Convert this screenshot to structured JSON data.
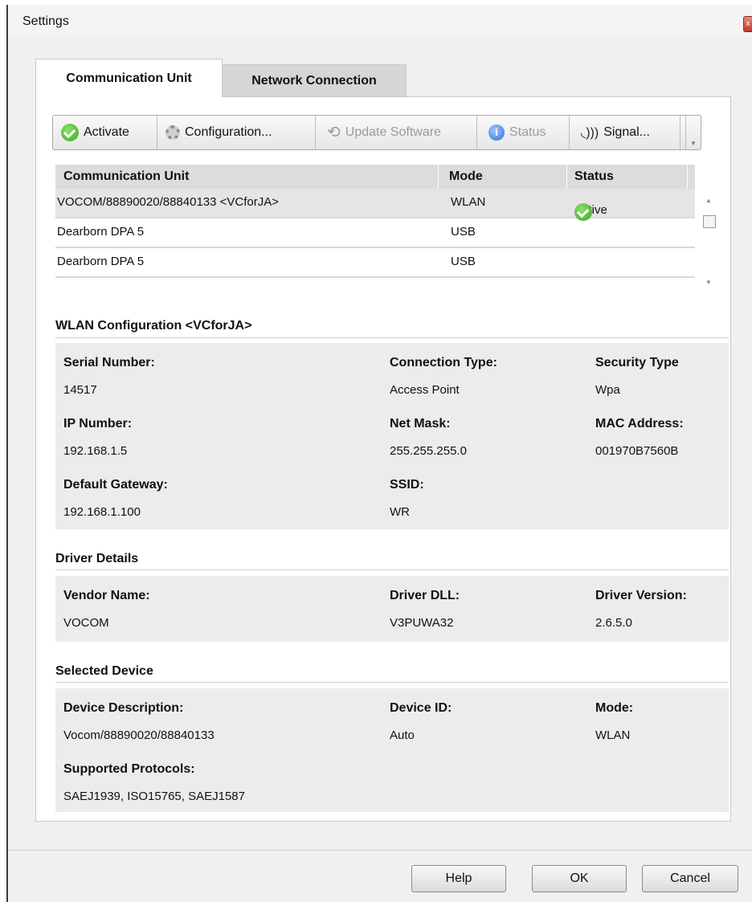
{
  "window": {
    "title": "Settings",
    "close_glyph": "x"
  },
  "tabs": [
    {
      "label": "Communication Unit",
      "active": true
    },
    {
      "label": "Network Connection",
      "active": false
    }
  ],
  "toolbar": {
    "activate": "Activate",
    "configuration": "Configuration...",
    "update_software": "Update Software",
    "status": "Status",
    "signal": "Signal..."
  },
  "units_table": {
    "columns": [
      "Communication Unit",
      "Mode",
      "Status"
    ],
    "rows": [
      {
        "unit": "VOCOM/88890020/88840133 <VCforJA>",
        "mode": "WLAN",
        "status": "Active",
        "selected": true
      },
      {
        "unit": "Dearborn DPA 5",
        "mode": "USB",
        "status": ""
      },
      {
        "unit": "Dearborn DPA 5",
        "mode": "USB",
        "status": ""
      }
    ]
  },
  "wlan": {
    "title": "WLAN Configuration <VCforJA>",
    "serial_label": "Serial Number:",
    "serial_value": "14517",
    "conn_type_label": "Connection Type:",
    "conn_type_value": "Access Point",
    "sec_type_label": "Security Type",
    "sec_type_value": "Wpa",
    "ip_label": "IP Number:",
    "ip_value": "192.168.1.5",
    "netmask_label": "Net Mask:",
    "netmask_value": "255.255.255.0",
    "mac_label": "MAC Address:",
    "mac_value": "001970B7560B",
    "gateway_label": "Default Gateway:",
    "gateway_value": "192.168.1.100",
    "ssid_label": "SSID:",
    "ssid_value": "WR"
  },
  "driver": {
    "title": "Driver Details",
    "vendor_label": "Vendor Name:",
    "vendor_value": "VOCOM",
    "dll_label": "Driver DLL:",
    "dll_value": "V3PUWA32",
    "version_label": "Driver Version:",
    "version_value": "2.6.5.0"
  },
  "device": {
    "title": "Selected Device",
    "desc_label": "Device Description:",
    "desc_value": "Vocom/88890020/88840133",
    "id_label": "Device ID:",
    "id_value": "Auto",
    "mode_label": "Mode:",
    "mode_value": "WLAN",
    "protocols_label": "Supported Protocols:",
    "protocols_value": "SAEJ1939, ISO15765, SAEJ1587"
  },
  "footer": {
    "help": "Help",
    "ok": "OK",
    "cancel": "Cancel"
  }
}
